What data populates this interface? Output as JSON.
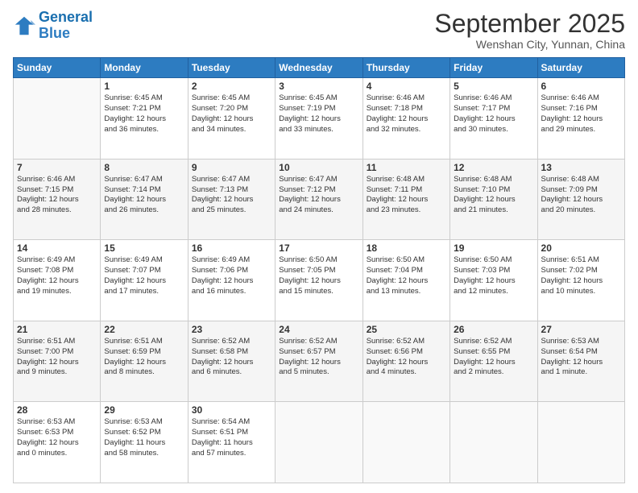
{
  "header": {
    "logo_line1": "General",
    "logo_line2": "Blue",
    "main_title": "September 2025",
    "subtitle": "Wenshan City, Yunnan, China"
  },
  "days_of_week": [
    "Sunday",
    "Monday",
    "Tuesday",
    "Wednesday",
    "Thursday",
    "Friday",
    "Saturday"
  ],
  "weeks": [
    [
      {
        "day": "",
        "info": ""
      },
      {
        "day": "1",
        "info": "Sunrise: 6:45 AM\nSunset: 7:21 PM\nDaylight: 12 hours\nand 36 minutes."
      },
      {
        "day": "2",
        "info": "Sunrise: 6:45 AM\nSunset: 7:20 PM\nDaylight: 12 hours\nand 34 minutes."
      },
      {
        "day": "3",
        "info": "Sunrise: 6:45 AM\nSunset: 7:19 PM\nDaylight: 12 hours\nand 33 minutes."
      },
      {
        "day": "4",
        "info": "Sunrise: 6:46 AM\nSunset: 7:18 PM\nDaylight: 12 hours\nand 32 minutes."
      },
      {
        "day": "5",
        "info": "Sunrise: 6:46 AM\nSunset: 7:17 PM\nDaylight: 12 hours\nand 30 minutes."
      },
      {
        "day": "6",
        "info": "Sunrise: 6:46 AM\nSunset: 7:16 PM\nDaylight: 12 hours\nand 29 minutes."
      }
    ],
    [
      {
        "day": "7",
        "info": "Sunrise: 6:46 AM\nSunset: 7:15 PM\nDaylight: 12 hours\nand 28 minutes."
      },
      {
        "day": "8",
        "info": "Sunrise: 6:47 AM\nSunset: 7:14 PM\nDaylight: 12 hours\nand 26 minutes."
      },
      {
        "day": "9",
        "info": "Sunrise: 6:47 AM\nSunset: 7:13 PM\nDaylight: 12 hours\nand 25 minutes."
      },
      {
        "day": "10",
        "info": "Sunrise: 6:47 AM\nSunset: 7:12 PM\nDaylight: 12 hours\nand 24 minutes."
      },
      {
        "day": "11",
        "info": "Sunrise: 6:48 AM\nSunset: 7:11 PM\nDaylight: 12 hours\nand 23 minutes."
      },
      {
        "day": "12",
        "info": "Sunrise: 6:48 AM\nSunset: 7:10 PM\nDaylight: 12 hours\nand 21 minutes."
      },
      {
        "day": "13",
        "info": "Sunrise: 6:48 AM\nSunset: 7:09 PM\nDaylight: 12 hours\nand 20 minutes."
      }
    ],
    [
      {
        "day": "14",
        "info": "Sunrise: 6:49 AM\nSunset: 7:08 PM\nDaylight: 12 hours\nand 19 minutes."
      },
      {
        "day": "15",
        "info": "Sunrise: 6:49 AM\nSunset: 7:07 PM\nDaylight: 12 hours\nand 17 minutes."
      },
      {
        "day": "16",
        "info": "Sunrise: 6:49 AM\nSunset: 7:06 PM\nDaylight: 12 hours\nand 16 minutes."
      },
      {
        "day": "17",
        "info": "Sunrise: 6:50 AM\nSunset: 7:05 PM\nDaylight: 12 hours\nand 15 minutes."
      },
      {
        "day": "18",
        "info": "Sunrise: 6:50 AM\nSunset: 7:04 PM\nDaylight: 12 hours\nand 13 minutes."
      },
      {
        "day": "19",
        "info": "Sunrise: 6:50 AM\nSunset: 7:03 PM\nDaylight: 12 hours\nand 12 minutes."
      },
      {
        "day": "20",
        "info": "Sunrise: 6:51 AM\nSunset: 7:02 PM\nDaylight: 12 hours\nand 10 minutes."
      }
    ],
    [
      {
        "day": "21",
        "info": "Sunrise: 6:51 AM\nSunset: 7:00 PM\nDaylight: 12 hours\nand 9 minutes."
      },
      {
        "day": "22",
        "info": "Sunrise: 6:51 AM\nSunset: 6:59 PM\nDaylight: 12 hours\nand 8 minutes."
      },
      {
        "day": "23",
        "info": "Sunrise: 6:52 AM\nSunset: 6:58 PM\nDaylight: 12 hours\nand 6 minutes."
      },
      {
        "day": "24",
        "info": "Sunrise: 6:52 AM\nSunset: 6:57 PM\nDaylight: 12 hours\nand 5 minutes."
      },
      {
        "day": "25",
        "info": "Sunrise: 6:52 AM\nSunset: 6:56 PM\nDaylight: 12 hours\nand 4 minutes."
      },
      {
        "day": "26",
        "info": "Sunrise: 6:52 AM\nSunset: 6:55 PM\nDaylight: 12 hours\nand 2 minutes."
      },
      {
        "day": "27",
        "info": "Sunrise: 6:53 AM\nSunset: 6:54 PM\nDaylight: 12 hours\nand 1 minute."
      }
    ],
    [
      {
        "day": "28",
        "info": "Sunrise: 6:53 AM\nSunset: 6:53 PM\nDaylight: 12 hours\nand 0 minutes."
      },
      {
        "day": "29",
        "info": "Sunrise: 6:53 AM\nSunset: 6:52 PM\nDaylight: 11 hours\nand 58 minutes."
      },
      {
        "day": "30",
        "info": "Sunrise: 6:54 AM\nSunset: 6:51 PM\nDaylight: 11 hours\nand 57 minutes."
      },
      {
        "day": "",
        "info": ""
      },
      {
        "day": "",
        "info": ""
      },
      {
        "day": "",
        "info": ""
      },
      {
        "day": "",
        "info": ""
      }
    ]
  ]
}
